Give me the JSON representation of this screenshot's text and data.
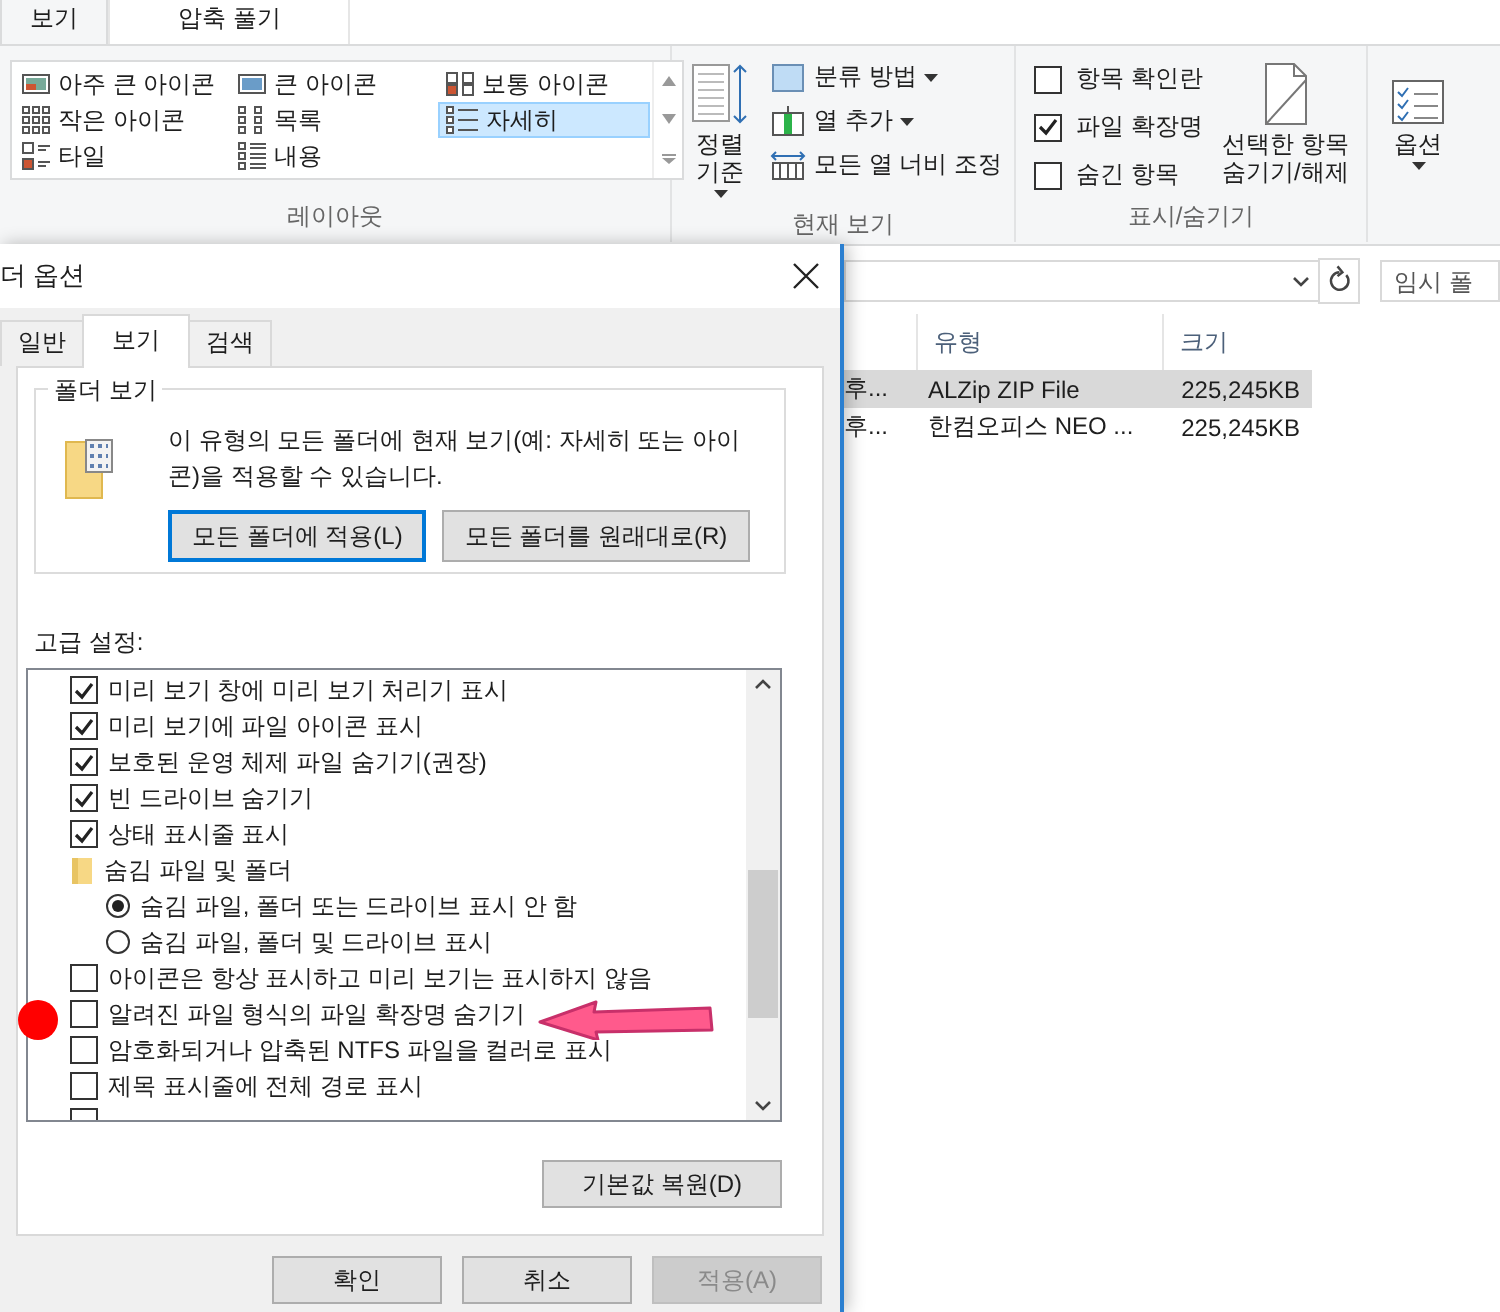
{
  "ribbon": {
    "tabs": [
      {
        "label": "보기",
        "selected": true
      },
      {
        "label": "압축 풀기",
        "selected": false
      }
    ],
    "layout": {
      "label": "레이아웃",
      "items": [
        {
          "label": "아주 큰 아이콘",
          "selected": false
        },
        {
          "label": "큰 아이콘",
          "selected": false
        },
        {
          "label": "보통 아이콘",
          "selected": false
        },
        {
          "label": "작은 아이콘",
          "selected": false
        },
        {
          "label": "목록",
          "selected": false
        },
        {
          "label": "자세히",
          "selected": true
        },
        {
          "label": "타일",
          "selected": false
        },
        {
          "label": "내용",
          "selected": false
        }
      ]
    },
    "current_view": {
      "label": "현재 보기",
      "sort_button": {
        "label": "정렬 기준",
        "dropdown": true
      },
      "commands": [
        {
          "label": "분류 방법",
          "dropdown": true
        },
        {
          "label": "열 추가",
          "dropdown": true
        },
        {
          "label": "모든 열 너비 조정",
          "dropdown": false
        }
      ]
    },
    "show_hide": {
      "label": "표시/숨기기",
      "checkboxes": [
        {
          "label": "항목 확인란",
          "checked": false
        },
        {
          "label": "파일 확장명",
          "checked": true
        },
        {
          "label": "숨긴 항목",
          "checked": false
        }
      ],
      "hide_button": "선택한 항목 숨기기/해제"
    },
    "options": {
      "label": "옵션",
      "dropdown": true
    }
  },
  "explorer": {
    "search": {
      "placeholder": "임시 폴"
    },
    "columns": [
      "유형",
      "크기"
    ],
    "rows": [
      {
        "column_1": "후...",
        "type": "ALZip ZIP File",
        "size": "225,245KB",
        "selected": true
      },
      {
        "column_1": "후...",
        "type": "한컴오피스 NEO ...",
        "size": "225,245KB",
        "selected": false
      }
    ]
  },
  "dialog": {
    "title": "더 옵션",
    "tabs": [
      {
        "label": "일반",
        "selected": false
      },
      {
        "label": "보기",
        "selected": true
      },
      {
        "label": "검색",
        "selected": false
      }
    ],
    "folder_view": {
      "legend": "폴더 보기",
      "text": "이 유형의 모든 폴더에 현재 보기(예: 자세히 또는 아이콘)을 적용할 수 있습니다.",
      "buttons": [
        "모든 폴더에 적용(L)",
        "모든 폴더를 원래대로(R)"
      ]
    },
    "advanced": {
      "label": "고급 설정:",
      "items": [
        {
          "kind": "checkbox",
          "label": "미리 보기 창에 미리 보기 처리기 표시",
          "checked": true
        },
        {
          "kind": "checkbox",
          "label": "미리 보기에 파일 아이콘 표시",
          "checked": true
        },
        {
          "kind": "checkbox",
          "label": "보호된 운영 체제 파일 숨기기(권장)",
          "checked": true
        },
        {
          "kind": "checkbox",
          "label": "빈 드라이브 숨기기",
          "checked": true
        },
        {
          "kind": "checkbox",
          "label": "상태 표시줄 표시",
          "checked": true
        },
        {
          "kind": "folder",
          "label": "숨김 파일 및 폴더",
          "children": [
            {
              "kind": "radio",
              "label": "숨김 파일, 폴더 또는 드라이브 표시 안 함",
              "selected": true
            },
            {
              "kind": "radio",
              "label": "숨김 파일, 폴더 및 드라이브 표시",
              "selected": false
            }
          ]
        },
        {
          "kind": "checkbox",
          "label": "아이콘은 항상 표시하고 미리 보기는 표시하지 않음",
          "checked": false
        },
        {
          "kind": "checkbox",
          "label": "알려진 파일 형식의 파일 확장명 숨기기",
          "checked": false
        },
        {
          "kind": "checkbox",
          "label": "암호화되거나 압축된 NTFS 파일을 컬러로 표시",
          "checked": false
        },
        {
          "kind": "checkbox",
          "label": "제목 표시줄에 전체 경로 표시",
          "checked": false
        }
      ],
      "restore_button": "기본값 복원(D)"
    },
    "footer_buttons": [
      {
        "label": "확인",
        "disabled": false
      },
      {
        "label": "취소",
        "disabled": false
      },
      {
        "label": "적용(A)",
        "disabled": true
      }
    ]
  }
}
